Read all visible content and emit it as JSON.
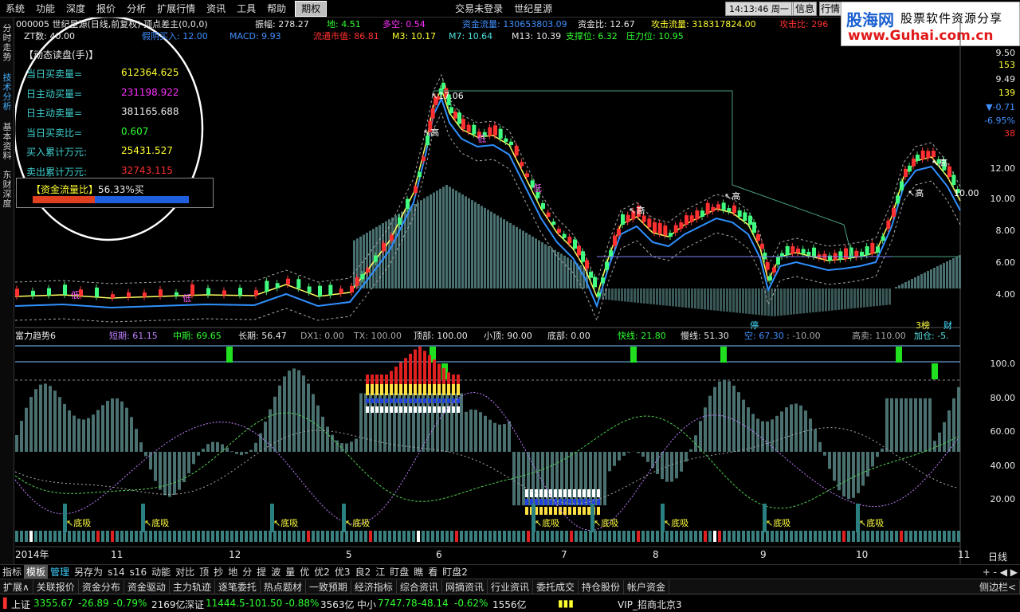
{
  "menu": {
    "items": [
      "系统",
      "功能",
      "深度",
      "报价",
      "分析",
      "扩展行情",
      "资讯",
      "工具",
      "帮助"
    ],
    "active": "期权",
    "login": "交易未登录",
    "stock": "世纪星源",
    "time": "14:13:46",
    "weekday": "周一",
    "news": "信息",
    "quote": "行情"
  },
  "logo": {
    "cn": "股海网",
    "slogan": "股票软件资源分享",
    "url": "www.Guhai.com.cn"
  },
  "side_tabs": [
    {
      "label": "分时走势",
      "sel": false
    },
    {
      "label": "技术分析",
      "sel": true
    },
    {
      "label": "基本资料",
      "sel": false
    },
    {
      "label": "东财深度",
      "sel": false
    }
  ],
  "header": {
    "row1": [
      {
        "t": "000005 世纪星源(日线,前复权) 顶点差主(0,0,0)",
        "c": "wht"
      },
      {
        "t": "振幅: 278.27",
        "c": "wht"
      },
      {
        "t": "地: 4.51",
        "c": "grn"
      },
      {
        "t": "多空: 0.54",
        "c": "mag"
      },
      {
        "t": "资金流量: 130653803.09",
        "c": "blu"
      },
      {
        "t": "资金比: 12.67",
        "c": "wht"
      },
      {
        "t": "攻击流量: 318317824.00",
        "c": "ylw"
      },
      {
        "t": "攻击比: 296",
        "c": "red"
      }
    ],
    "row2": [
      {
        "t": "ZT数: 40.00",
        "c": "wht"
      },
      {
        "t": "假阴买入: 12.00",
        "c": "blu"
      },
      {
        "t": "MACD: 9.93",
        "c": "blu"
      },
      {
        "t": "流通市值: 86.81",
        "c": "red"
      },
      {
        "t": "M3: 10.17",
        "c": "ylw"
      },
      {
        "t": "M7: 10.64",
        "c": "cyn"
      },
      {
        "t": "M13: 10.39",
        "c": "wht"
      },
      {
        "t": "支撑位: 6.32",
        "c": "grn"
      },
      {
        "t": "压力位: 10.95",
        "c": "grn"
      }
    ]
  },
  "readout": {
    "title": "【动态读盘(手)】",
    "rows": [
      {
        "label": "当日买卖量=",
        "value": "612364.625",
        "c": "ylw"
      },
      {
        "label": "日主动买量=",
        "value": "231198.922",
        "c": "mag"
      },
      {
        "label": "日主动卖量=",
        "value": "381165.688",
        "c": "wht"
      },
      {
        "label": "当日买卖比=",
        "value": "0.607",
        "c": "grn"
      },
      {
        "label": "买入累计万元:",
        "value": "25431.527",
        "c": "ylw"
      },
      {
        "label": "卖出累计万元:",
        "value": "32743.115",
        "c": "red"
      }
    ],
    "fund_label": "【资金流量比】",
    "fund_pct": "56.33%买",
    "fund_ratio": 0.4
  },
  "annotations": {
    "high_label": "高",
    "low_label": "低",
    "peak_price": "17.06",
    "right_price": "10.00",
    "stop": "停",
    "mark1": "3榜",
    "mark2": "财",
    "suck": "底吸"
  },
  "sub_header": [
    {
      "t": "富力趋势6",
      "c": "wht"
    },
    {
      "t": "短期: 61.15",
      "c": "pur"
    },
    {
      "t": "中期: 69.65",
      "c": "grn"
    },
    {
      "t": "长期: 56.47",
      "c": "wht"
    },
    {
      "t": "DX1: 0.00",
      "c": "gry"
    },
    {
      "t": "TX: 100.00",
      "c": "gry"
    },
    {
      "t": "顶部: 100.00",
      "c": "wht"
    },
    {
      "t": "小顶: 90.00",
      "c": "wht"
    },
    {
      "t": "底部: 0.00",
      "c": "wht"
    },
    {
      "t": "快线: 21.80",
      "c": "grn"
    },
    {
      "t": "慢线: 51.30",
      "c": "wht"
    },
    {
      "t": "空: 67.30",
      "c": "blu"
    },
    {
      "t": ": -10.00",
      "c": "gry"
    },
    {
      "t": "高卖: 110.00",
      "c": "gry"
    },
    {
      "t": "加仓: -5.",
      "c": "cyn"
    }
  ],
  "price_scale": [
    {
      "v": "9.50",
      "c": "wht"
    },
    {
      "v": "153",
      "c": "ylw"
    },
    {
      "v": "9.49",
      "c": "wht"
    },
    {
      "v": "139",
      "c": "ylw"
    },
    {
      "v": "▼-0.71",
      "c": "blu"
    },
    {
      "v": "-6.95%",
      "c": "blu"
    },
    {
      "v": "38",
      "c": "red"
    },
    {
      "v": "12.00",
      "c": "wht"
    },
    {
      "v": "10.00",
      "c": "wht"
    },
    {
      "v": "8.00",
      "c": "wht"
    },
    {
      "v": "6.00",
      "c": "wht"
    },
    {
      "v": "4.00",
      "c": "wht"
    }
  ],
  "sub_scale": [
    "100.0",
    "80.00",
    "60.00",
    "40.00",
    "20.00"
  ],
  "x_axis": [
    "2014年",
    "11",
    "12",
    "5",
    "6",
    "7",
    "8",
    "9",
    "10",
    "11"
  ],
  "x_axis_right": "日线",
  "toolbar1": {
    "items": [
      "指标",
      "模板",
      "管理",
      "另存为",
      "s14",
      "s16",
      "动能",
      "对比",
      "顶",
      "抄",
      "地",
      "分",
      "提",
      "波",
      "量",
      "优",
      "优2",
      "优3",
      "良2",
      "江",
      "盯盘",
      "瞧",
      "看",
      "盯盘2"
    ],
    "selected": "模板",
    "blue": "管理",
    "right": "+ - ◀ ▶"
  },
  "toolbar2": {
    "items": [
      "扩展∧",
      "关联报价",
      "资金分布",
      "资金驱动",
      "主力轨迹",
      "逐笔委托",
      "热点题材",
      "一致预期",
      "经济指标",
      "综合资讯",
      "网摘资讯",
      "行业资讯",
      "委托成交",
      "持仓股份",
      "帐户资金"
    ],
    "right": "侧边栏<"
  },
  "status": {
    "sh_label": "上证",
    "sh": "3355.67",
    "sh_chg": "-26.89",
    "sh_pct": "-0.79%",
    "sh_amt": "2169亿",
    "sz_label": "深证",
    "sz": "11444.5",
    "sz_chg": "-101.50",
    "sz_pct": "-0.88%",
    "sz_amt": "3563亿",
    "zx_label": "中小",
    "zx": "7747.78",
    "zx_chg": "-48.14",
    "zx_pct": "-0.62%",
    "zx_amt": "1556亿",
    "vip": "VIP_招商北京3"
  }
}
